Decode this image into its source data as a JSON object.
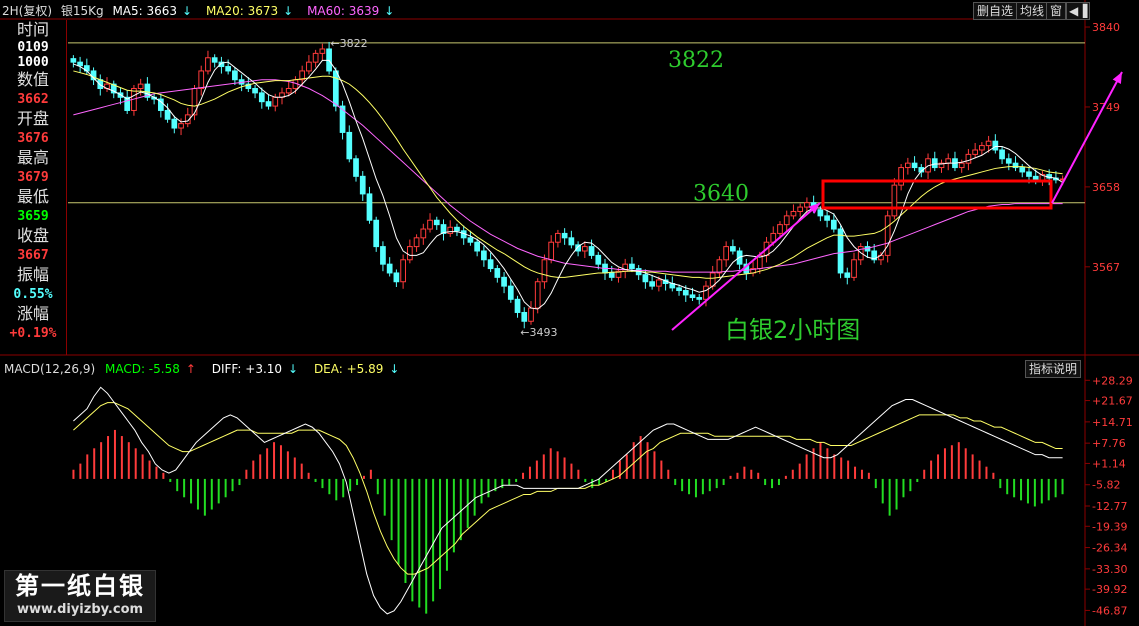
{
  "header": {
    "period": "2H(复权)",
    "symbol": "银15Kg",
    "ma5_label": "MA5: 3663",
    "ma20_label": "MA20: 3673",
    "ma60_label": "MA60: 3639",
    "ma5_arrow": "↓",
    "ma20_arrow": "↓",
    "ma60_arrow": "↓"
  },
  "toolbar": {
    "btn1": "删自选",
    "btn2": "均线",
    "btn3": "窗"
  },
  "sidebar": {
    "time_label": "时间",
    "time_value1": "0109",
    "time_value2": "1000",
    "value_label": "数值",
    "value": "3662",
    "open_label": "开盘",
    "open": "3676",
    "high_label": "最高",
    "high": "3679",
    "low_label": "最低",
    "low": "3659",
    "close_label": "收盘",
    "close": "3667",
    "amplitude_label": "振幅",
    "amplitude": "0.55%",
    "change_label": "涨幅",
    "change": "+0.19%"
  },
  "macd_header": {
    "name": "MACD(12,26,9)",
    "macd": "MACD: -5.58",
    "diff": "DIFF: +3.10",
    "dea": "DEA: +5.89",
    "macd_arrow": "↑",
    "diff_arrow": "↓",
    "dea_arrow": "↓"
  },
  "hint_button": "指标说明",
  "watermark": {
    "line1": "第一纸白银",
    "line2": "www.diyizby.com"
  },
  "colors": {
    "up": "#ff3b3b",
    "down": "#54ffff",
    "ma5": "#ffffff",
    "ma20": "#ffff66",
    "ma60": "#ff66ff",
    "annotation": "#ff22ff",
    "box": "#ff0000",
    "level_line": "#c8c870"
  },
  "chart_data": [
    {
      "type": "candlestick",
      "title": "白银2小时图",
      "y_ticks": [
        "3840",
        "3749",
        "3658",
        "3567"
      ],
      "ylim": [
        3470,
        3848
      ],
      "annotations": {
        "high_label": "3822",
        "low_label": "3493",
        "level_top": "3822",
        "level_mid": "3640",
        "chart_title": "白银2小时图"
      },
      "levels": [
        3822,
        3640
      ],
      "close_path": [
        3800,
        3796,
        3790,
        3780,
        3770,
        3775,
        3765,
        3760,
        3745,
        3770,
        3775,
        3760,
        3758,
        3745,
        3735,
        3725,
        3730,
        3740,
        3770,
        3790,
        3805,
        3800,
        3795,
        3790,
        3780,
        3775,
        3770,
        3765,
        3755,
        3750,
        3760,
        3765,
        3770,
        3780,
        3790,
        3800,
        3810,
        3815,
        3790,
        3750,
        3720,
        3690,
        3670,
        3650,
        3620,
        3590,
        3570,
        3560,
        3550,
        3575,
        3590,
        3600,
        3610,
        3620,
        3615,
        3605,
        3612,
        3608,
        3600,
        3595,
        3585,
        3575,
        3565,
        3555,
        3545,
        3530,
        3515,
        3505,
        3520,
        3550,
        3575,
        3595,
        3605,
        3600,
        3592,
        3585,
        3590,
        3580,
        3570,
        3560,
        3555,
        3562,
        3570,
        3565,
        3558,
        3550,
        3545,
        3552,
        3548,
        3543,
        3540,
        3535,
        3532,
        3530,
        3545,
        3560,
        3575,
        3590,
        3585,
        3570,
        3560,
        3565,
        3580,
        3595,
        3605,
        3615,
        3625,
        3630,
        3635,
        3640,
        3632,
        3625,
        3620,
        3610,
        3560,
        3555,
        3575,
        3590,
        3585,
        3575,
        3580,
        3625,
        3660,
        3680,
        3685,
        3680,
        3675,
        3690,
        3680,
        3685,
        3690,
        3680,
        3685,
        3695,
        3700,
        3705,
        3710,
        3700,
        3690,
        3685,
        3680,
        3675,
        3670,
        3665,
        3672,
        3668,
        3666,
        3667
      ],
      "ma5": [
        3798,
        3795,
        3790,
        3782,
        3774,
        3770,
        3767,
        3763,
        3758,
        3762,
        3766,
        3764,
        3760,
        3755,
        3748,
        3738,
        3732,
        3733,
        3742,
        3758,
        3777,
        3791,
        3799,
        3800,
        3794,
        3788,
        3782,
        3776,
        3769,
        3763,
        3760,
        3760,
        3762,
        3767,
        3775,
        3783,
        3792,
        3802,
        3802,
        3791,
        3775,
        3755,
        3733,
        3713,
        3690,
        3667,
        3648,
        3625,
        3600,
        3585,
        3580,
        3580,
        3583,
        3593,
        3602,
        3606,
        3607,
        3607,
        3605,
        3602,
        3598,
        3592,
        3584,
        3575,
        3565,
        3553,
        3541,
        3527,
        3520,
        3519,
        3525,
        3537,
        3553,
        3568,
        3580,
        3590,
        3595,
        3594,
        3588,
        3580,
        3572,
        3567,
        3564,
        3563,
        3562,
        3560,
        3557,
        3554,
        3551,
        3548,
        3546,
        3543,
        3541,
        3538,
        3540,
        3545,
        3552,
        3562,
        3572,
        3578,
        3580,
        3579,
        3578,
        3580,
        3585,
        3593,
        3603,
        3613,
        3622,
        3630,
        3634,
        3634,
        3631,
        3627,
        3615,
        3600,
        3590,
        3583,
        3578,
        3576,
        3580,
        3591,
        3608,
        3628,
        3650,
        3666,
        3676,
        3682,
        3684,
        3684,
        3685,
        3685,
        3686,
        3688,
        3691,
        3694,
        3699,
        3704,
        3704,
        3701,
        3696,
        3689,
        3682,
        3676,
        3671,
        3669,
        3668,
        3663
      ],
      "ma20": [
        3790,
        3788,
        3786,
        3783,
        3780,
        3777,
        3774,
        3771,
        3768,
        3767,
        3767,
        3766,
        3765,
        3763,
        3760,
        3757,
        3753,
        3751,
        3750,
        3752,
        3755,
        3758,
        3762,
        3766,
        3769,
        3772,
        3774,
        3776,
        3777,
        3778,
        3779,
        3779,
        3779,
        3780,
        3781,
        3782,
        3783,
        3784,
        3784,
        3782,
        3779,
        3775,
        3769,
        3762,
        3754,
        3745,
        3735,
        3724,
        3713,
        3701,
        3690,
        3679,
        3668,
        3657,
        3646,
        3637,
        3628,
        3620,
        3613,
        3607,
        3601,
        3596,
        3591,
        3586,
        3582,
        3577,
        3572,
        3567,
        3563,
        3560,
        3558,
        3556,
        3555,
        3555,
        3556,
        3557,
        3558,
        3559,
        3560,
        3560,
        3561,
        3561,
        3562,
        3562,
        3562,
        3561,
        3561,
        3560,
        3559,
        3558,
        3557,
        3556,
        3555,
        3555,
        3554,
        3554,
        3555,
        3556,
        3557,
        3558,
        3559,
        3560,
        3562,
        3564,
        3567,
        3570,
        3574,
        3578,
        3583,
        3588,
        3592,
        3596,
        3600,
        3603,
        3603,
        3602,
        3602,
        3603,
        3604,
        3605,
        3608,
        3613,
        3619,
        3626,
        3633,
        3640,
        3647,
        3653,
        3658,
        3662,
        3665,
        3667,
        3669,
        3671,
        3673,
        3675,
        3677,
        3679,
        3680,
        3681,
        3681,
        3681,
        3680,
        3679,
        3677,
        3675,
        3674,
        3673
      ],
      "ma60": [
        3740,
        3742,
        3744,
        3746,
        3748,
        3750,
        3752,
        3754,
        3756,
        3758,
        3760,
        3762,
        3764,
        3765,
        3766,
        3767,
        3768,
        3769,
        3770,
        3771,
        3772,
        3773,
        3774,
        3775,
        3776,
        3777,
        3778,
        3779,
        3780,
        3780,
        3780,
        3779,
        3778,
        3776,
        3773,
        3770,
        3766,
        3762,
        3757,
        3752,
        3746,
        3740,
        3734,
        3728,
        3721,
        3714,
        3707,
        3700,
        3693,
        3686,
        3679,
        3672,
        3665,
        3658,
        3651,
        3644,
        3637,
        3631,
        3625,
        3619,
        3614,
        3609,
        3604,
        3600,
        3596,
        3592,
        3588,
        3585,
        3582,
        3579,
        3577,
        3575,
        3573,
        3571,
        3570,
        3569,
        3568,
        3567,
        3566,
        3565,
        3565,
        3564,
        3564,
        3563,
        3563,
        3563,
        3562,
        3562,
        3562,
        3561,
        3561,
        3561,
        3561,
        3561,
        3561,
        3561,
        3561,
        3562,
        3562,
        3563,
        3563,
        3564,
        3565,
        3566,
        3567,
        3568,
        3569,
        3570,
        3572,
        3574,
        3576,
        3578,
        3580,
        3582,
        3583,
        3584,
        3585,
        3587,
        3588,
        3590,
        3592,
        3594,
        3597,
        3600,
        3603,
        3606,
        3609,
        3612,
        3615,
        3618,
        3621,
        3624,
        3627,
        3630,
        3632,
        3634,
        3636,
        3637,
        3638,
        3638,
        3639,
        3639,
        3639,
        3639,
        3639,
        3639,
        3639,
        3639
      ]
    },
    {
      "type": "macd",
      "y_ticks": [
        "+28.29",
        "+21.67",
        "+14.71",
        "+7.76",
        "+1.14",
        "-5.82",
        "-12.77",
        "-19.39",
        "-26.34",
        "-33.30",
        "-39.92",
        "-46.87"
      ],
      "ylim": [
        -50,
        31
      ],
      "histogram": [
        3,
        5,
        8,
        10,
        12,
        14,
        16,
        14,
        12,
        10,
        8,
        6,
        4,
        2,
        -1,
        -4,
        -6,
        -8,
        -10,
        -12,
        -10,
        -8,
        -6,
        -4,
        -2,
        3,
        6,
        8,
        10,
        12,
        11,
        9,
        7,
        5,
        2,
        -1,
        -3,
        -5,
        -7,
        -6,
        -4,
        -2,
        1,
        3,
        -5,
        -12,
        -20,
        -28,
        -34,
        -40,
        -42,
        -44,
        -40,
        -36,
        -30,
        -24,
        -20,
        -16,
        -12,
        -8,
        -6,
        -4,
        -3,
        -2,
        -1,
        2,
        4,
        6,
        8,
        10,
        9,
        7,
        5,
        3,
        -1,
        -3,
        -2,
        -1,
        3,
        6,
        8,
        12,
        14,
        12,
        9,
        6,
        3,
        -2,
        -4,
        -5,
        -6,
        -5,
        -4,
        -3,
        -2,
        1,
        2,
        4,
        3,
        2,
        -2,
        -3,
        -2,
        1,
        3,
        5,
        8,
        10,
        12,
        10,
        8,
        7,
        6,
        4,
        3,
        2,
        -3,
        -8,
        -12,
        -10,
        -6,
        -4,
        -1,
        3,
        6,
        8,
        10,
        11,
        12,
        10,
        8,
        6,
        4,
        2,
        -3,
        -5,
        -6,
        -7,
        -8,
        -9,
        -8,
        -7,
        -6,
        -5
      ],
      "diff": [
        15,
        17,
        19,
        23,
        26,
        24,
        21,
        18,
        15,
        12,
        8,
        5,
        1,
        -1,
        -2,
        -1,
        2,
        5,
        8,
        10,
        12,
        14,
        16,
        17,
        16,
        14,
        12,
        10,
        8,
        9,
        10,
        11,
        12,
        13,
        14,
        13,
        11,
        8,
        5,
        1,
        -5,
        -15,
        -25,
        -35,
        -42,
        -46,
        -48,
        -47,
        -44,
        -40,
        -36,
        -32,
        -28,
        -24,
        -20,
        -18,
        -16,
        -14,
        -12,
        -10,
        -9,
        -8,
        -7,
        -6,
        -6,
        -6,
        -7,
        -7,
        -7,
        -7,
        -7,
        -7,
        -7,
        -7,
        -7,
        -6,
        -5,
        -4,
        -2,
        0,
        2,
        4,
        6,
        8,
        10,
        12,
        13,
        14,
        14,
        13,
        12,
        11,
        10,
        9,
        9,
        9,
        9,
        10,
        11,
        12,
        13,
        12,
        11,
        10,
        9,
        8,
        7,
        6,
        5,
        4,
        3,
        3,
        4,
        6,
        8,
        10,
        12,
        14,
        16,
        18,
        20,
        21,
        22,
        22,
        21,
        20,
        19,
        18,
        17,
        16,
        15,
        14,
        13,
        12,
        11,
        10,
        9,
        8,
        7,
        6,
        5,
        4,
        4,
        3,
        3,
        3
      ],
      "dea": [
        12,
        14,
        16,
        18,
        20,
        21,
        21,
        20,
        19,
        17,
        15,
        13,
        11,
        9,
        7,
        6,
        5,
        5,
        6,
        7,
        8,
        9,
        10,
        11,
        12,
        12,
        12,
        11,
        11,
        11,
        11,
        11,
        11,
        12,
        12,
        12,
        12,
        11,
        10,
        9,
        7,
        3,
        -2,
        -8,
        -15,
        -21,
        -26,
        -30,
        -33,
        -35,
        -35,
        -34,
        -33,
        -31,
        -29,
        -27,
        -25,
        -22,
        -20,
        -18,
        -16,
        -14,
        -13,
        -12,
        -11,
        -10,
        -9,
        -9,
        -8,
        -8,
        -8,
        -7,
        -7,
        -7,
        -7,
        -7,
        -6,
        -6,
        -5,
        -4,
        -3,
        -1,
        1,
        3,
        5,
        6,
        8,
        9,
        10,
        11,
        11,
        11,
        11,
        11,
        10,
        10,
        10,
        10,
        10,
        10,
        10,
        10,
        10,
        10,
        10,
        10,
        9,
        9,
        9,
        8,
        8,
        7,
        7,
        7,
        7,
        8,
        9,
        10,
        11,
        12,
        13,
        14,
        15,
        16,
        17,
        17,
        17,
        17,
        17,
        17,
        16,
        16,
        15,
        15,
        14,
        13,
        13,
        12,
        11,
        10,
        9,
        8,
        8,
        7,
        6,
        6
      ]
    }
  ]
}
